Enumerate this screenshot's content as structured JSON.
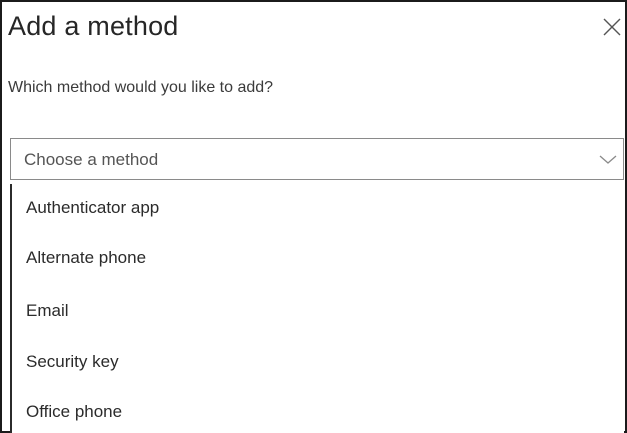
{
  "dialog": {
    "title": "Add a method",
    "close_icon": "close-icon",
    "prompt": "Which method would you like to add?",
    "select": {
      "value": "Choose a method",
      "chevron_icon": "chevron-down-icon"
    },
    "options": [
      {
        "label": "Authenticator app"
      },
      {
        "label": "Alternate phone"
      },
      {
        "label": "Email"
      },
      {
        "label": "Security key"
      },
      {
        "label": "Office phone"
      }
    ]
  },
  "colors": {
    "text_primary": "#262626",
    "text_secondary": "#555555",
    "border": "#8a8a8a",
    "background": "#ffffff"
  }
}
